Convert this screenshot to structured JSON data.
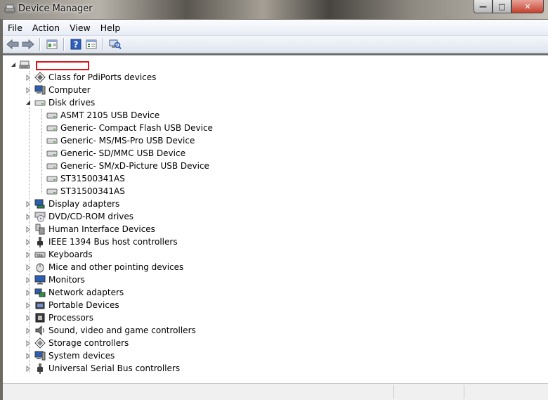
{
  "window": {
    "title": "Device Manager"
  },
  "menu": [
    "File",
    "Action",
    "View",
    "Help"
  ],
  "toolbar": [
    {
      "name": "back-button",
      "icon": "back-arrow-icon"
    },
    {
      "name": "forward-button",
      "icon": "forward-arrow-icon"
    },
    {
      "name": "show-hide-console-tree-button",
      "icon": "console-tree-icon"
    },
    {
      "name": "help-button",
      "icon": "help-icon"
    },
    {
      "name": "properties-button",
      "icon": "properties-icon"
    },
    {
      "name": "scan-hardware-button",
      "icon": "scan-hardware-icon"
    }
  ],
  "tree": {
    "root": {
      "label": "",
      "icon": "computer-root-icon",
      "expanded": true
    },
    "categories": [
      {
        "label": "Class for PdiPorts devices",
        "icon": "pdiports-icon",
        "expanded": false
      },
      {
        "label": "Computer",
        "icon": "computer-icon",
        "expanded": false
      },
      {
        "label": "Disk drives",
        "icon": "disk-drive-icon",
        "expanded": true,
        "children": [
          "ASMT 2105 USB Device",
          "Generic- Compact Flash USB Device",
          "Generic- MS/MS-Pro USB Device",
          "Generic- SD/MMC USB Device",
          "Generic- SM/xD-Picture USB Device",
          "ST31500341AS",
          "ST31500341AS"
        ]
      },
      {
        "label": "Display adapters",
        "icon": "display-adapter-icon",
        "expanded": false
      },
      {
        "label": "DVD/CD-ROM drives",
        "icon": "dvd-drive-icon",
        "expanded": false
      },
      {
        "label": "Human Interface Devices",
        "icon": "hid-icon",
        "expanded": false
      },
      {
        "label": "IEEE 1394 Bus host controllers",
        "icon": "firewire-icon",
        "expanded": false
      },
      {
        "label": "Keyboards",
        "icon": "keyboard-icon",
        "expanded": false
      },
      {
        "label": "Mice and other pointing devices",
        "icon": "mouse-icon",
        "expanded": false
      },
      {
        "label": "Monitors",
        "icon": "monitor-icon",
        "expanded": false
      },
      {
        "label": "Network adapters",
        "icon": "network-adapter-icon",
        "expanded": false
      },
      {
        "label": "Portable Devices",
        "icon": "portable-device-icon",
        "expanded": false
      },
      {
        "label": "Processors",
        "icon": "processor-icon",
        "expanded": false
      },
      {
        "label": "Sound, video and game controllers",
        "icon": "sound-icon",
        "expanded": false
      },
      {
        "label": "Storage controllers",
        "icon": "storage-controller-icon",
        "expanded": false
      },
      {
        "label": "System devices",
        "icon": "system-devices-icon",
        "expanded": false
      },
      {
        "label": "Universal Serial Bus controllers",
        "icon": "usb-icon",
        "expanded": false
      }
    ]
  },
  "colors": {
    "redaction_border": "#e0131a",
    "menu_bg": "#f4f6fb",
    "accent": "#2b5fb4"
  }
}
